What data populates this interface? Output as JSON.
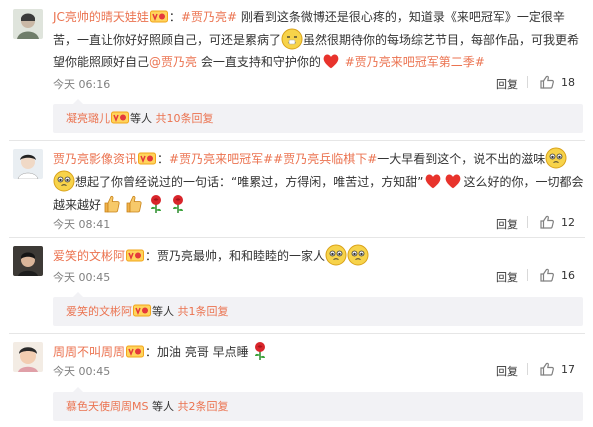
{
  "comments": [
    {
      "user": "JC亮帅的晴天娃娃",
      "colon": "：",
      "topic1": "#贾乃亮#",
      "text1": " 刚看到这条微博还是很心疼的，知道录《来吧冠军》一定很辛苦，一直让你好好照顾自己，可还是累病了",
      "text2": "虽然很期待你的每场综艺节目，每部作品，可我更希望你能照顾好自己",
      "mention": "@贾乃亮",
      "text3": " 会一直支持和守护你的",
      "topic2": "#贾乃亮来吧冠军第二季#",
      "time": "今天 06:16",
      "reply": "回复",
      "likes": "18",
      "sub": {
        "user": "凝亮璐儿",
        "mid": "等人",
        "count": "共10条回复"
      }
    },
    {
      "user": "贾乃亮影像资讯",
      "colon": "：",
      "topic1": "#贾乃亮来吧冠军#",
      "topic2": "#贾乃亮兵临棋下#",
      "text1": "一大早看到这个，说不出的滋味",
      "text2": "想起了你曾经说过的一句话：“唯累过，方得闲，唯苦过，方知甜”",
      "text3": "这么好的你，一切都会越来越好",
      "time": "今天 08:41",
      "reply": "回复",
      "likes": "12"
    },
    {
      "user": "爱笑的文彬阿",
      "colon": "：",
      "text1": "贾乃亮最帅，和和睦睦的一家人",
      "time": "今天 00:45",
      "reply": "回复",
      "likes": "16",
      "sub": {
        "user": "爱笑的文彬阿",
        "mid": "等人",
        "count": "共1条回复"
      }
    },
    {
      "user": "周周不叫周周",
      "colon": "：",
      "text1": "加油  亮哥  早点睡",
      "time": "今天 00:45",
      "reply": "回复",
      "likes": "17",
      "sub": {
        "user": "慕色天使周周MS",
        "mid": "等人",
        "count": "共2条回复"
      }
    }
  ],
  "colors": {
    "link": "#eb7350",
    "meta": "#808080",
    "subbox": "#f2f2f5"
  }
}
